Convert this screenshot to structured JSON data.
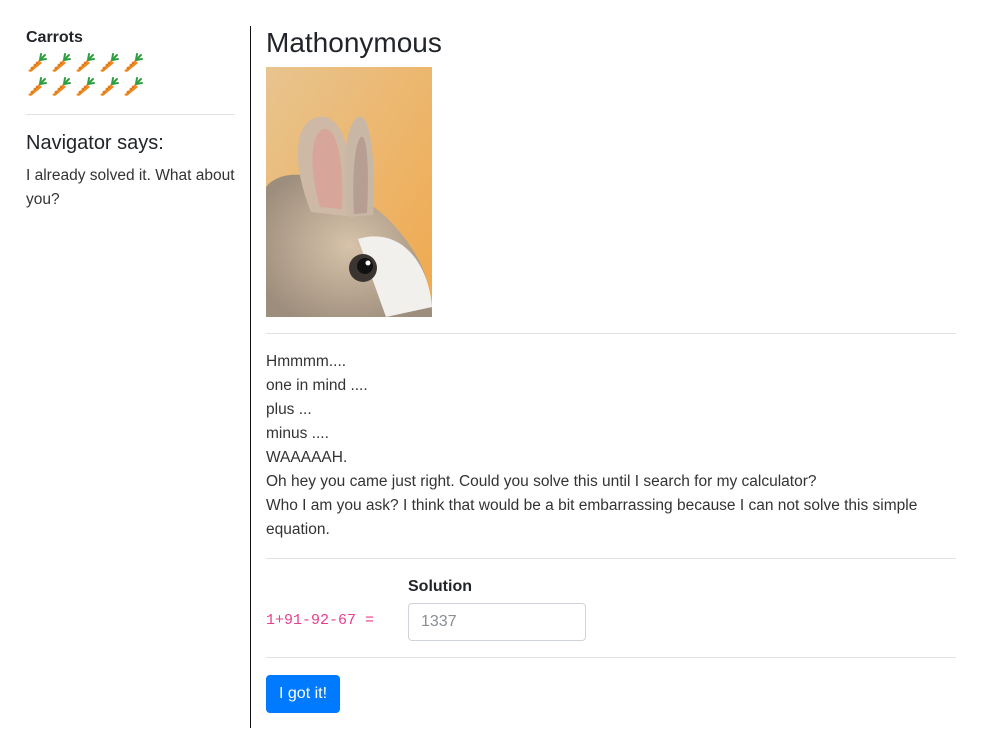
{
  "sidebar": {
    "carrots_title": "Carrots",
    "carrot_count": 10,
    "navigator_title": "Navigator says:",
    "navigator_text": "I already solved it. What about you?"
  },
  "main": {
    "title": "Mathonymous",
    "story_lines": [
      "Hmmmm....",
      "one in mind ....",
      "plus ...",
      "minus ....",
      "WAAAAAH.",
      "Oh hey you came just right. Could you solve this until I search for my calculator?",
      "Who I am you ask? I think that would be a bit embarrassing because I can not solve this simple equation."
    ],
    "equation": "1+91-92-67 =",
    "solution_label": "Solution",
    "solution_placeholder": "1337",
    "submit_label": "I got it!"
  },
  "colors": {
    "accent": "#007bff",
    "equation": "#e83e8c",
    "carrot": "#f08a24",
    "carrot_leaf": "#2e9e3e"
  },
  "icons": {
    "carrot": "carrot-icon",
    "image": "rabbit-photo"
  }
}
